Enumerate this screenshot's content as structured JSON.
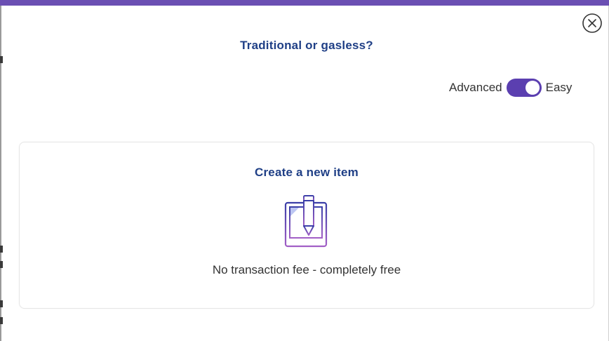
{
  "dialog": {
    "title": "Traditional or gasless?",
    "close_icon": "close-circle-icon",
    "accent_color": "#6b4fb3",
    "title_color": "#1f3f86"
  },
  "mode_toggle": {
    "left_label": "Advanced",
    "right_label": "Easy",
    "selected": "Easy",
    "on_color": "#5b3fb0"
  },
  "option_card": {
    "title": "Create a new item",
    "icon": "tablet-pencil-icon",
    "description": "No transaction fee - completely free"
  }
}
